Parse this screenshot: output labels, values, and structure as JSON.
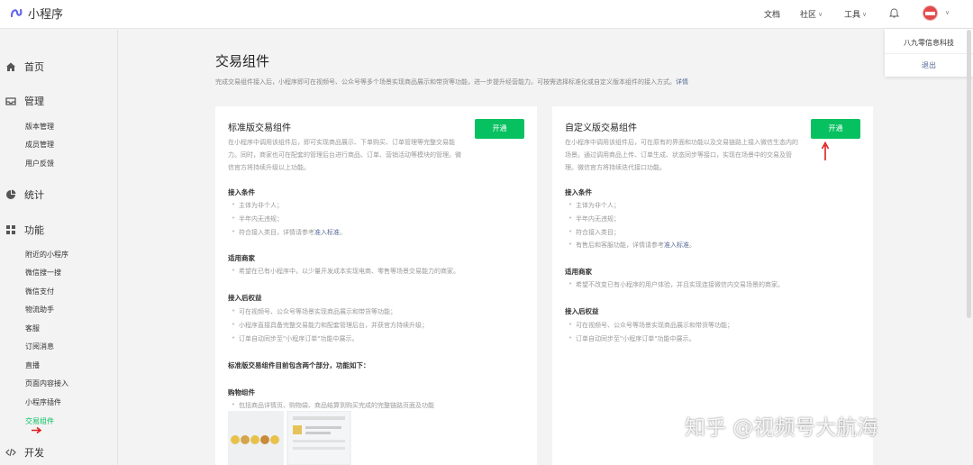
{
  "header": {
    "app_name": "小程序",
    "nav": [
      "文档",
      "社区",
      "工具"
    ],
    "brand_color": "#07c160"
  },
  "user_menu": {
    "org_name": "八九零信息科技",
    "logout": "退出"
  },
  "sidebar": {
    "home": "首页",
    "manage": "管理",
    "manage_items": [
      "版本管理",
      "成员管理",
      "用户反馈"
    ],
    "stats": "统计",
    "features": "功能",
    "feature_items": [
      "附近的小程序",
      "微信搜一搜",
      "微信支付",
      "物流助手",
      "客服",
      "订阅消息",
      "直播",
      "页面内容接入",
      "小程序插件",
      "交易组件"
    ],
    "dev": "开发"
  },
  "main": {
    "title": "交易组件",
    "desc": "完成交易组件接入后，小程序即可在视频号、公众号等多个场景实现商品展示和带货等功能，进一步提升经营能力。可按需选择标准化或自定义版本组件的接入方式。",
    "desc_link": "详情"
  },
  "standard": {
    "title": "标准版交易组件",
    "button": "开通",
    "desc": "在小程序中调用该组件后，即可实现商品展示、下单购买、订单管理等完整交易能力。同时，商家也可在配套的管理后台进行商品、订单、营销活动等模块的管理。微信官方将持续升级以上功能。",
    "cond_title": "接入条件",
    "cond": [
      "主体为非个人；",
      "半年内无违规；"
    ],
    "cond3": "符合接入类目，详情请参考",
    "cond3_link": "准入标准",
    "cond3_end": "。",
    "merchant_title": "适用商家",
    "merchant": [
      "希望在已有小程序中，以少量开发成本实现电商、零售等场景交易能力的商家。"
    ],
    "rights_title": "接入后权益",
    "rights": [
      "可在视频号、公众号等场景实现商品展示和带货等功能；",
      "小程序直接具备完整交易能力和配套管理后台，并获官方持续升级；",
      "订单自动同步至\"小程序订单\"功能中展示。"
    ],
    "parts_title": "标准版交易组件目前包含两个部分，功能如下：",
    "cart_title": "购物组件",
    "cart": [
      "包括商品详情页、购物袋、商品结算到购买完成的完整链路页面及功能"
    ]
  },
  "custom": {
    "title": "自定义版交易组件",
    "button": "开通",
    "desc": "在小程序中调用该组件后，可在原有的界面和功能以及交易链路上接入微信生态内的场景。通过调用商品上传、订单生成、状态同步等接口，实现在场景中的交易及管理。微信官方将持续迭代接口功能。",
    "cond_title": "接入条件",
    "cond": [
      "主体为非个人；",
      "半年内无违规；",
      "符合接入类目；"
    ],
    "cond4": "有售后和客服功能，详情请参考",
    "cond4_link": "准入标准",
    "cond4_end": "。",
    "merchant_title": "适用商家",
    "merchant": [
      "希望不改变已有小程序的用户体验，并且实现连接微信内交易场景的商家。"
    ],
    "rights_title": "接入后权益",
    "rights": [
      "可在视频号、公众号等场景实现商品展示和带货等功能；",
      "订单自动同步至\"小程序订单\"功能中展示。"
    ]
  },
  "watermark": "知乎 @视频号大航海"
}
